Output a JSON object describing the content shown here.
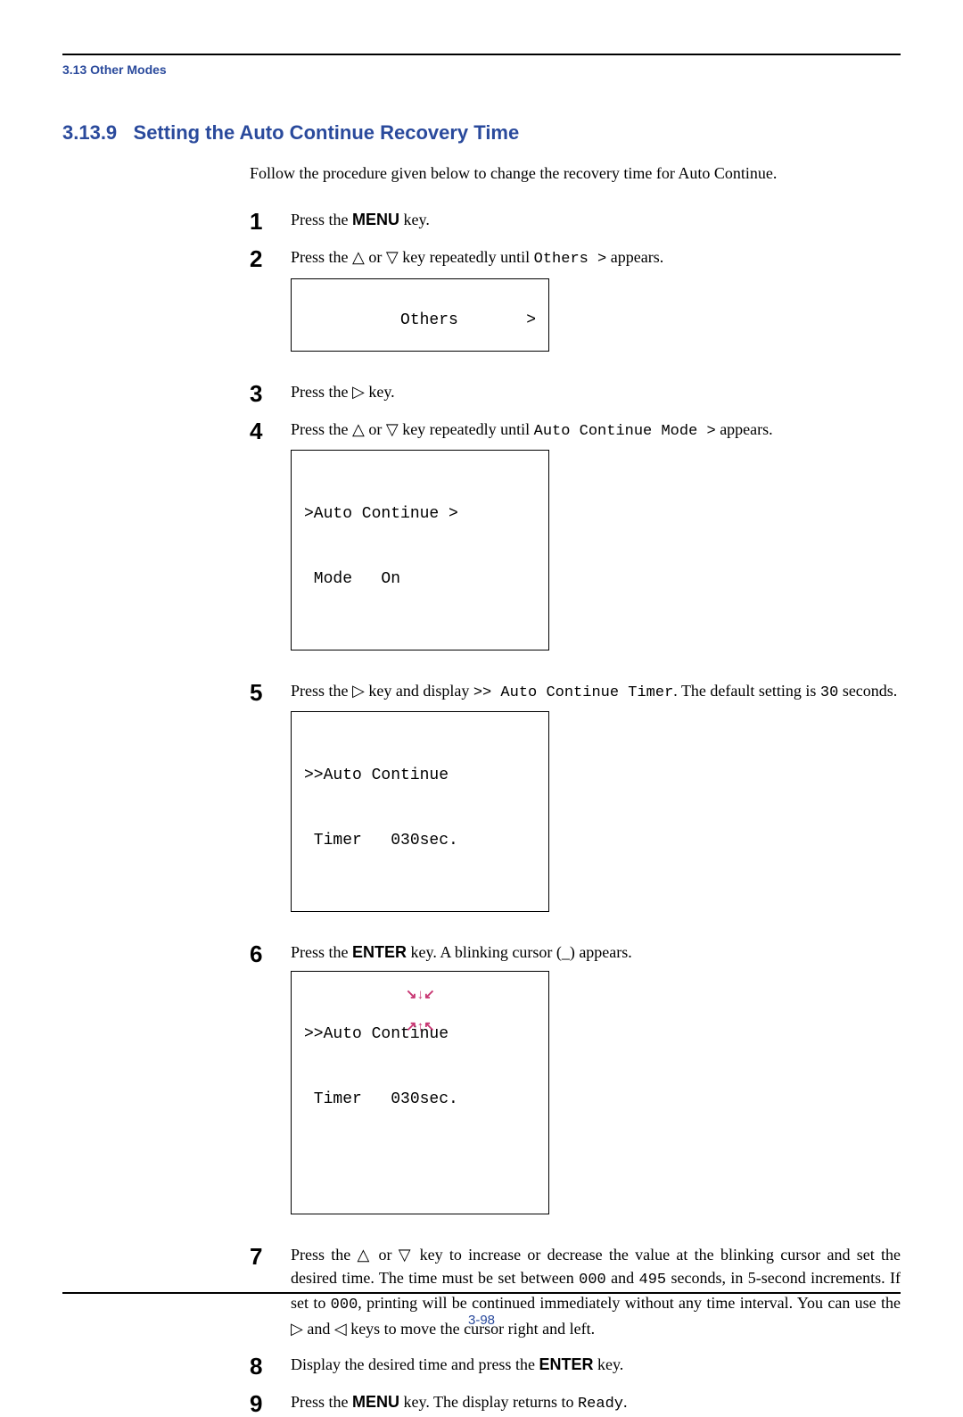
{
  "header": {
    "running": "3.13 Other Modes"
  },
  "section": {
    "number": "3.13.9",
    "title": "Setting the Auto Continue Recovery Time"
  },
  "intro": "Follow the procedure given below to change the recovery time for Auto Continue.",
  "tri": {
    "up": "△",
    "down": "▽",
    "right": "▷",
    "left": "◁"
  },
  "steps": {
    "s1": {
      "t1": "Press the ",
      "key": "MENU",
      "t2": " key."
    },
    "s2": {
      "t1": "Press the ",
      "t2": " or ",
      "t3": " key repeatedly until ",
      "mono": "Others  >",
      "t4": " appears."
    },
    "lcd1": {
      "line1": "Others",
      "gt": ">"
    },
    "s3": {
      "t1": "Press the ",
      "t2": " key."
    },
    "s4": {
      "t1": "Press the ",
      "t2": " or ",
      "t3": " key repeatedly until ",
      "mono": "Auto Continue Mode >",
      "t4": " appears."
    },
    "lcd2": {
      "line1": ">Auto Continue >",
      "line2": " Mode   On"
    },
    "s5": {
      "t1": "Press the ",
      "t2": " key and display ",
      "mono1": ">> Auto Continue Timer",
      "t3": ". The default setting is ",
      "mono2": "30",
      "t4": " seconds."
    },
    "lcd3": {
      "line1": ">>Auto Continue",
      "line2": " Timer   030sec."
    },
    "s6": {
      "t1": "Press the ",
      "key": "ENTER",
      "t2": " key. A blinking cursor (_) appears."
    },
    "lcd4": {
      "line1": ">>Auto Continue",
      "line2": " Timer   030sec."
    },
    "s7": {
      "t1": "Press the ",
      "t2": " or ",
      "t3": " key to increase or decrease the value at the blinking cursor and set the desired time. The time must be set between ",
      "mono1": "000",
      "t4": " and ",
      "mono2": "495",
      "t5": " seconds, in 5-second increments. If set to ",
      "mono3": "000",
      "t6": ", printing will be continued immediately without any time interval. You can use the ",
      "t7": " and ",
      "t8": " keys to move the cursor right and left."
    },
    "s8": {
      "t1": "Display the desired time and press the ",
      "key": "ENTER",
      "t2": " key."
    },
    "s9": {
      "t1": "Press the ",
      "key": "MENU",
      "t2": " key. The display returns to ",
      "mono": "Ready",
      "t3": "."
    }
  },
  "footer": {
    "page_number": "3-98"
  }
}
